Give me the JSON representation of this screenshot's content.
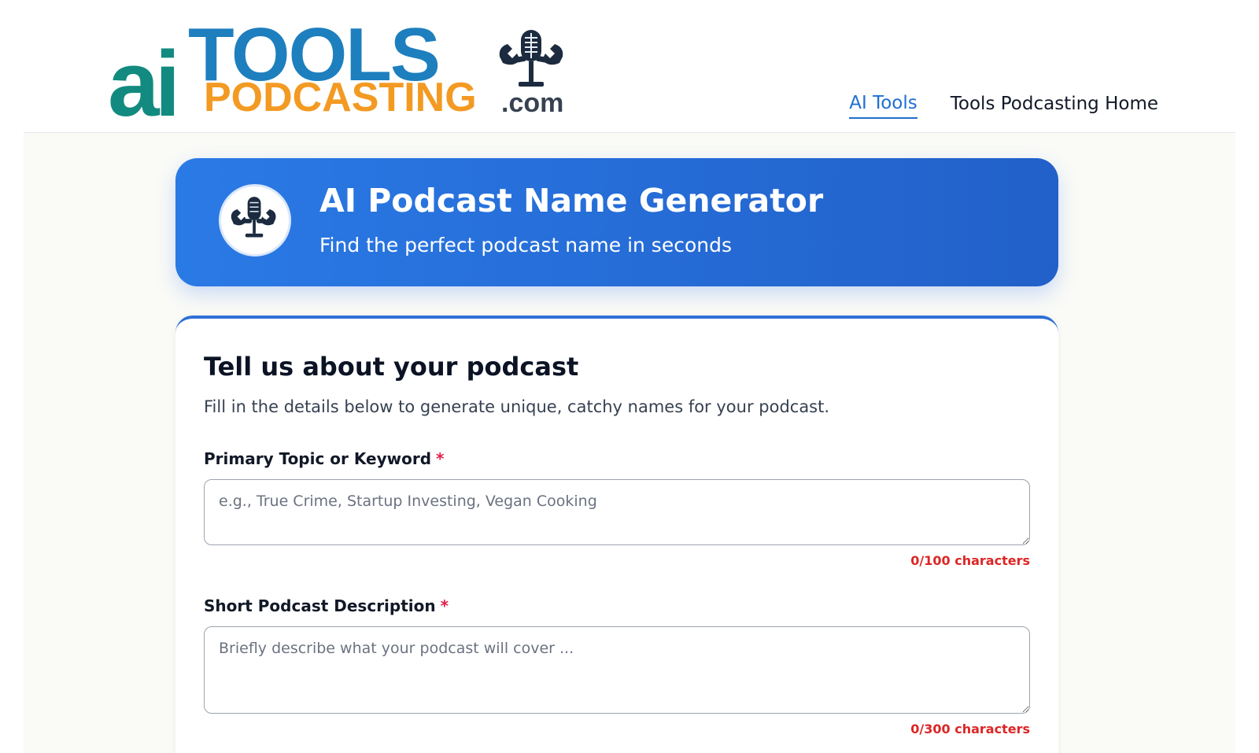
{
  "brand": {
    "logo_ai": "ai",
    "logo_tools": "TOOLS",
    "logo_podcasting": "PODCASTING",
    "logo_dotcom": ".com",
    "logo_icon": "microphone-wrench-icon",
    "colors": {
      "ai": "#138a80",
      "tools": "#1d7fbe",
      "podcasting": "#f39a23"
    }
  },
  "nav": {
    "items": [
      {
        "label": "AI Tools",
        "active": true
      },
      {
        "label": "Tools Podcasting Home",
        "active": false
      }
    ]
  },
  "hero": {
    "title": "AI Podcast Name Generator",
    "subtitle": "Find the perfect podcast name in seconds",
    "icon": "microphone-wrench-icon",
    "gradient": [
      "#2a7ae6",
      "#2260c9"
    ]
  },
  "form": {
    "title": "Tell us about your podcast",
    "subtitle": "Fill in the details below to generate unique, catchy names for your podcast.",
    "fields": [
      {
        "label": "Primary Topic or Keyword",
        "required_mark": "*",
        "value": "",
        "placeholder": "e.g., True Crime, Startup Investing, Vegan Cooking",
        "counter": "0/100 characters"
      },
      {
        "label": "Short Podcast Description",
        "required_mark": "*",
        "value": "",
        "placeholder": "Briefly describe what your podcast will cover ...",
        "counter": "0/300 characters"
      }
    ]
  }
}
